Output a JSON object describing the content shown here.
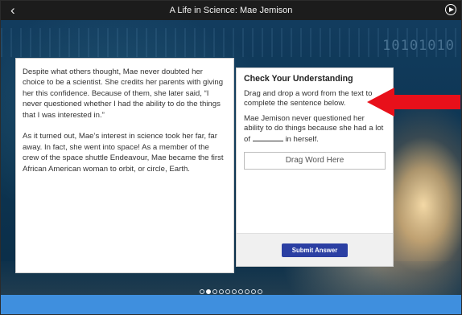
{
  "header": {
    "back_icon": "chevron-left-icon",
    "title": "A Life in Science: Mae Jemison",
    "play_icon": "play-circle-icon"
  },
  "background": {
    "binary_text": "10101010"
  },
  "passage": {
    "paragraphs": [
      "Despite what others thought, Mae never doubted her choice to be a scientist. She credits her parents with giving her this confidence. Because of them, she later said, “I never questioned whether I had the ability to do the things that I was interested in.”",
      "As it turned out, Mae’s interest in science took her far, far away. In fact, she went into space! As a member of the crew of the space shuttle Endeavour, Mae became the first African American woman to orbit, or circle, Earth."
    ]
  },
  "check": {
    "heading": "Check Your Understanding",
    "instruction": "Drag and drop a word from the text to complete the sentence below.",
    "sentence_before": "Mae Jemison never questioned her ability to do things because she had a lot of",
    "sentence_after": "in herself.",
    "dropzone_label": "Drag Word Here",
    "submit_label": "Submit Answer"
  },
  "pager": {
    "total": 10,
    "current": 2
  },
  "colors": {
    "arrow": "#e8101a",
    "submit": "#2b3fa3",
    "bottom_bar": "#3f8fde",
    "top_bar": "#1c1c1c"
  }
}
